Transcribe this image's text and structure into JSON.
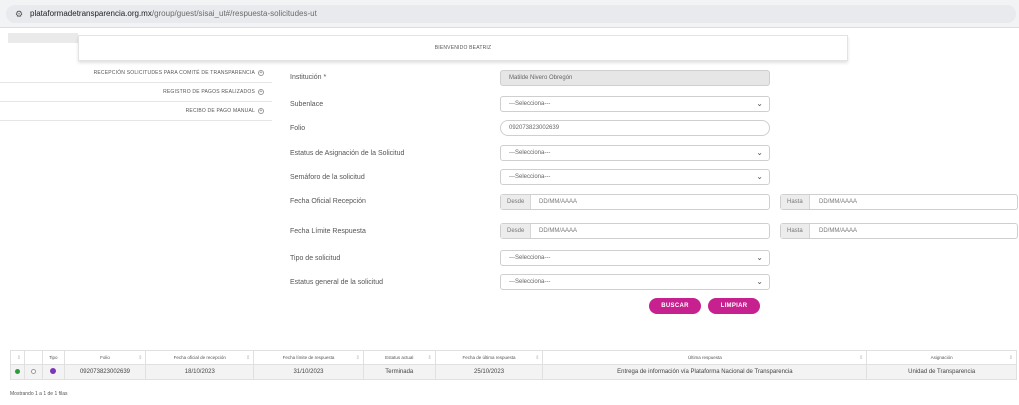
{
  "browser": {
    "url_host": "plataformadetransparencia.org.mx",
    "url_path": "/group/guest/sisai_ut#/respuesta-solicitudes-ut",
    "site_icon": "tune-icon"
  },
  "header": {
    "welcome": "BIENVENIDO BEATRIZ"
  },
  "sidebar": {
    "items": [
      {
        "label": "RECEPCIÓN SOLICITUDES PARA COMITÉ DE TRANSPARENCIA"
      },
      {
        "label": "REGISTRO DE PAGOS REALIZADOS"
      },
      {
        "label": "RECIBO DE PAGO MANUAL"
      }
    ],
    "expand_symbol": "+"
  },
  "form": {
    "institucion_label": "Institución *",
    "institucion_value": "Matilde Nivero Obregón",
    "subenlace_label": "Subenlace",
    "subenlace_value": "---Selecciona---",
    "folio_label": "Folio",
    "folio_value": "092073823002639",
    "estatus_asignacion_label": "Estatus de Asignación de la Solicitud",
    "estatus_asignacion_value": "---Selecciona---",
    "semaforo_label": "Semáforo de la solicitud",
    "semaforo_value": "---Selecciona---",
    "fecha_oficial_label": "Fecha Oficial Recepción",
    "fecha_limite_label": "Fecha Límite Respuesta",
    "desde": "Desde",
    "hasta": "Hasta",
    "date_placeholder": "DD/MM/AAAA",
    "tipo_label": "Tipo de solicitud",
    "tipo_value": "---Selecciona---",
    "estatus_general_label": "Estatus general de la solicitud",
    "estatus_general_value": "---Selecciona---",
    "buscar": "BUSCAR",
    "limpiar": "LIMPIAR",
    "chevron": "⌄"
  },
  "table": {
    "headers": [
      "",
      "",
      "Tipo",
      "Folio",
      "Fecha oficial de recepción",
      "Fecha límite de respuesta",
      "Estatus actual",
      "Fecha de última respuesta",
      "Última respuesta",
      "Asignación"
    ],
    "row": {
      "folio": "092073823002639",
      "fecha_recepcion": "18/10/2023",
      "fecha_limite": "31/10/2023",
      "estatus": "Terminada",
      "fecha_ultima": "25/10/2023",
      "ultima_respuesta": "Entrega de información vía Plataforma Nacional de Transparencia",
      "asignacion": "Unidad de Transparencia"
    },
    "footer": "Mostrando 1 a 1 de 1 filas",
    "colors": {
      "status_green": "#2a9d3a",
      "type_purple": "#7a36b8",
      "accent": "#c6218f"
    }
  }
}
